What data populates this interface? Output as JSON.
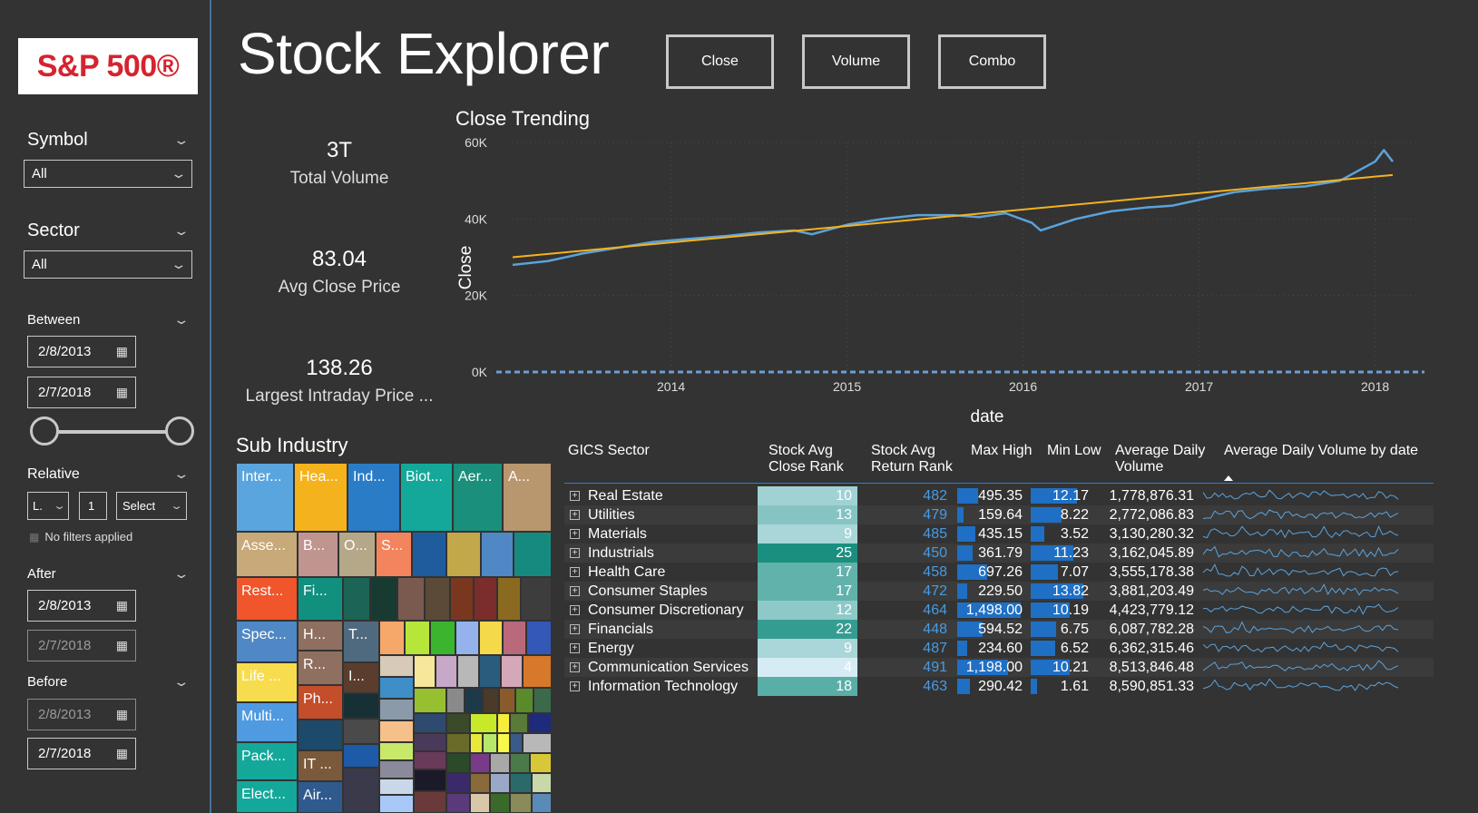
{
  "logo": {
    "text": "S&P 500®"
  },
  "sidebar": {
    "symbol": {
      "label": "Symbol",
      "value": "All"
    },
    "sector": {
      "label": "Sector",
      "value": "All"
    },
    "between": {
      "label": "Between",
      "start": "2/8/2013",
      "end": "2/7/2018",
      "range_fraction": [
        0,
        1
      ]
    },
    "relative": {
      "label": "Relative",
      "mode": "L.",
      "count": "1",
      "unit": "Select",
      "status": "No filters applied"
    },
    "after": {
      "label": "After",
      "start": "2/8/2013",
      "end": "2/7/2018"
    },
    "before": {
      "label": "Before",
      "start": "2/8/2013",
      "end": "2/7/2018"
    }
  },
  "header": {
    "title": "Stock Explorer",
    "buttons": [
      "Close",
      "Volume",
      "Combo"
    ]
  },
  "kpis": [
    {
      "value": "3T",
      "label": "Total Volume"
    },
    {
      "value": "83.04",
      "label": "Avg Close Price"
    },
    {
      "value": "138.26",
      "label": "Largest Intraday Price ..."
    }
  ],
  "chart_data": {
    "type": "line",
    "title": "Close Trending",
    "xlabel": "date",
    "ylabel": "Close",
    "x_ticks": [
      "2014",
      "2015",
      "2016",
      "2017",
      "2018"
    ],
    "y_ticks": [
      "0K",
      "20K",
      "40K",
      "60K"
    ],
    "xlim": [
      2013.1,
      2018.1
    ],
    "ylim": [
      0,
      60000
    ],
    "grid": true,
    "series": [
      {
        "color": "#5ba3dc",
        "x": [
          2013.1,
          2013.3,
          2013.5,
          2013.7,
          2013.9,
          2014.1,
          2014.3,
          2014.5,
          2014.7,
          2014.8,
          2015.0,
          2015.2,
          2015.4,
          2015.6,
          2015.75,
          2015.9,
          2016.05,
          2016.1,
          2016.3,
          2016.5,
          2016.7,
          2016.85,
          2017.0,
          2017.2,
          2017.4,
          2017.6,
          2017.8,
          2018.0,
          2018.05,
          2018.1
        ],
        "values": [
          28000,
          29000,
          31000,
          32500,
          34000,
          34800,
          35500,
          36500,
          37000,
          36000,
          38500,
          40000,
          41000,
          41000,
          40500,
          41500,
          39000,
          37000,
          40000,
          42000,
          43000,
          43500,
          45000,
          47000,
          48000,
          48500,
          50000,
          55000,
          58000,
          55000
        ]
      },
      {
        "color": "#f5b21d",
        "x": [
          2013.1,
          2018.1
        ],
        "values": [
          30000,
          51500
        ]
      }
    ],
    "baseline_value": 0
  },
  "treemap": {
    "title": "Sub Industry",
    "tiles": [
      "Inter...",
      "Hea...",
      "Ind...",
      "Biot...",
      "Aer...",
      "A...",
      "Asse...",
      "B...",
      "O...",
      "S...",
      "Rest...",
      "Fi...",
      "Spec...",
      "H...",
      "T...",
      "Life ...",
      "R...",
      "I...",
      "Ph...",
      "Multi...",
      "Pack...",
      "IT ...",
      "Elect...",
      "Air..."
    ]
  },
  "table": {
    "headers": [
      "GICS Sector",
      "Stock Avg Close Rank",
      "Stock Avg Return Rank",
      "Max High",
      "Min Low",
      "Average Daily Volume",
      "Average Daily Volume by date"
    ],
    "rows": [
      {
        "sector": "Real Estate",
        "close_rank": "10",
        "return_rank": "482",
        "max_high": "495.35",
        "min_low": "12.17",
        "avg_vol": "1,778,876.31"
      },
      {
        "sector": "Utilities",
        "close_rank": "13",
        "return_rank": "479",
        "max_high": "159.64",
        "min_low": "8.22",
        "avg_vol": "2,772,086.83"
      },
      {
        "sector": "Materials",
        "close_rank": "9",
        "return_rank": "485",
        "max_high": "435.15",
        "min_low": "3.52",
        "avg_vol": "3,130,280.32"
      },
      {
        "sector": "Industrials",
        "close_rank": "25",
        "return_rank": "450",
        "max_high": "361.79",
        "min_low": "11.23",
        "avg_vol": "3,162,045.89"
      },
      {
        "sector": "Health Care",
        "close_rank": "17",
        "return_rank": "458",
        "max_high": "697.26",
        "min_low": "7.07",
        "avg_vol": "3,555,178.38"
      },
      {
        "sector": "Consumer Staples",
        "close_rank": "17",
        "return_rank": "472",
        "max_high": "229.50",
        "min_low": "13.82",
        "avg_vol": "3,881,203.49"
      },
      {
        "sector": "Consumer Discretionary",
        "close_rank": "12",
        "return_rank": "464",
        "max_high": "1,498.00",
        "min_low": "10.19",
        "avg_vol": "4,423,779.12"
      },
      {
        "sector": "Financials",
        "close_rank": "22",
        "return_rank": "448",
        "max_high": "594.52",
        "min_low": "6.75",
        "avg_vol": "6,087,782.28"
      },
      {
        "sector": "Energy",
        "close_rank": "9",
        "return_rank": "487",
        "max_high": "234.60",
        "min_low": "6.52",
        "avg_vol": "6,362,315.46"
      },
      {
        "sector": "Communication Services",
        "close_rank": "4",
        "return_rank": "491",
        "max_high": "1,198.00",
        "min_low": "10.21",
        "avg_vol": "8,513,846.48"
      },
      {
        "sector": "Information Technology",
        "close_rank": "18",
        "return_rank": "463",
        "max_high": "290.42",
        "min_low": "1.61",
        "avg_vol": "8,590,851.33"
      }
    ]
  },
  "colors": {
    "accent_blue": "#1f6fc4",
    "trend_line": "#f5b21d",
    "series_line": "#5ba3dc",
    "teal_high": "#1a8f80",
    "teal_low": "#d6ecf4",
    "return_rank_blue": "#4a9ae0"
  }
}
